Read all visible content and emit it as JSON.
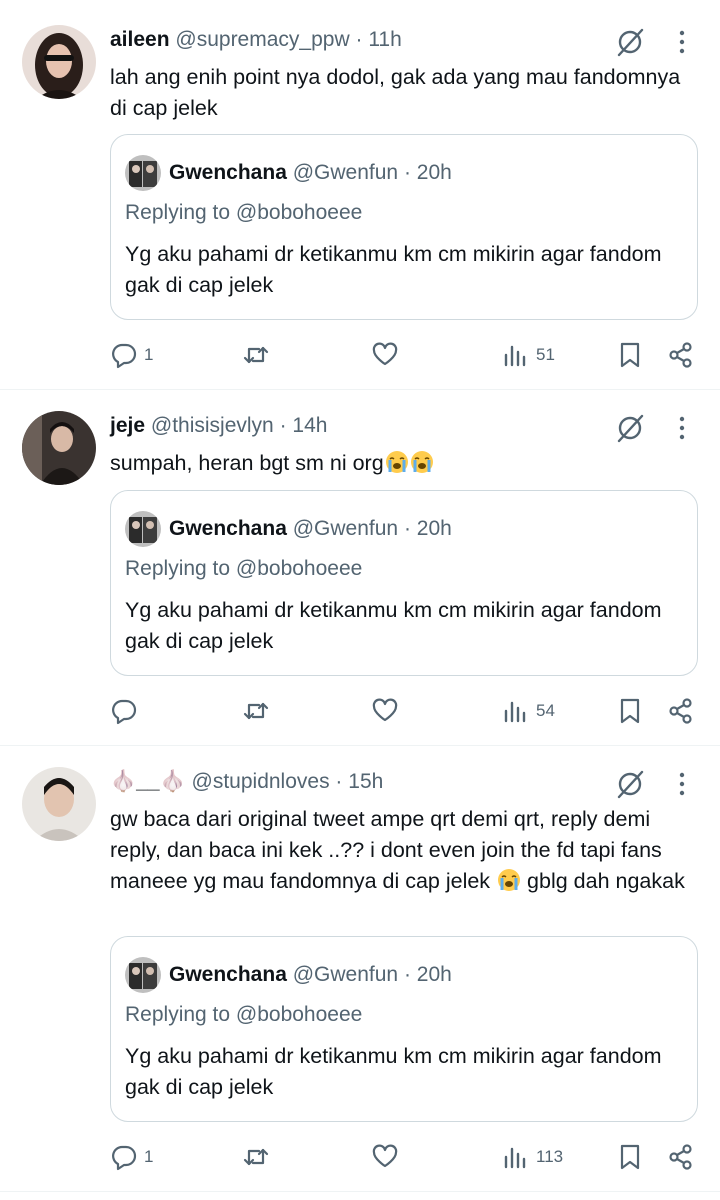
{
  "tweets": [
    {
      "name": "aileen",
      "name_prefix": "",
      "name_suffix": "",
      "handle": "@supremacy_ppw",
      "time": "11h",
      "text": "lah ang enih point nya dodol, gak ada yang mau fandomnya di cap jelek",
      "quote": {
        "name": "Gwenchana",
        "handle": "@Gwenfun",
        "time": "20h",
        "replying": "Replying to @bobohoeee",
        "text": "Yg aku pahami dr ketikanmu km cm mikirin agar fandom gak di cap jelek"
      },
      "stats": {
        "replies": "1",
        "retweets": "",
        "likes": "",
        "views": "51"
      }
    },
    {
      "name": "jeje",
      "name_prefix": "",
      "name_suffix": "",
      "handle": "@thisisjevlyn",
      "time": "14h",
      "text": "sumpah, heran bgt sm ni org",
      "quote": {
        "name": "Gwenchana",
        "handle": "@Gwenfun",
        "time": "20h",
        "replying": "Replying to @bobohoeee",
        "text": "Yg aku pahami dr ketikanmu km cm mikirin agar fandom gak di cap jelek"
      },
      "stats": {
        "replies": "",
        "retweets": "",
        "likes": "",
        "views": "54"
      }
    },
    {
      "name": "__",
      "name_prefix": "🧄",
      "name_suffix": "🧄",
      "handle": "@stupidnloves",
      "time": "15h",
      "text": "gw baca dari original tweet ampe qrt demi qrt, reply demi reply, dan baca ini kek ..?? i dont even join the fd tapi fans maneee yg mau fandomnya di cap jelek",
      "text_after_emoji": "gblg dah ngakak",
      "quote": {
        "name": "Gwenchana",
        "handle": "@Gwenfun",
        "time": "20h",
        "replying": "Replying to @bobohoeee",
        "text": "Yg aku pahami dr ketikanmu km cm mikirin agar fandom gak di cap jelek"
      },
      "stats": {
        "replies": "1",
        "retweets": "",
        "likes": "",
        "views": "113"
      }
    }
  ],
  "separator": "·",
  "icons": {
    "reply": "reply-icon",
    "retweet": "retweet-icon",
    "like": "heart-icon",
    "views": "views-icon",
    "bookmark": "bookmark-icon",
    "share": "share-icon",
    "grok": "grok-icon",
    "more": "more-icon",
    "emoji": "loudly-crying-face-emoji"
  },
  "colors": {
    "text": "#0f1419",
    "secondary": "#536471",
    "border": "#cfd9de"
  }
}
